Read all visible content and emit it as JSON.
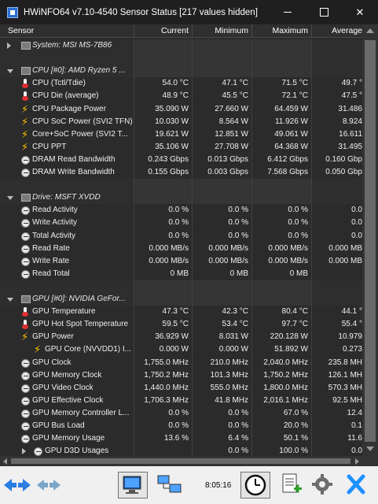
{
  "window": {
    "title": "HWiNFO64 v7.10-4540 Sensor Status [217 values hidden]",
    "minimize_glyph": "",
    "maximize_glyph": "",
    "close_glyph": "✕"
  },
  "columns": {
    "sensor": "Sensor",
    "current": "Current",
    "minimum": "Minimum",
    "maximum": "Maximum",
    "average": "Average"
  },
  "rows": [
    {
      "kind": "group",
      "icon": "chip",
      "expanded": false,
      "label": "System: MSI MS-7B86",
      "cur": "",
      "min": "",
      "max": "",
      "avg": ""
    },
    {
      "kind": "spacer",
      "label": "",
      "cur": "",
      "min": "",
      "max": "",
      "avg": ""
    },
    {
      "kind": "group",
      "icon": "chip",
      "expanded": true,
      "label": "CPU [#0]: AMD Ryzen 5 ...",
      "cur": "",
      "min": "",
      "max": "",
      "avg": ""
    },
    {
      "kind": "item",
      "icon": "thermometer",
      "label": "CPU (Tctl/Tdie)",
      "cur": "54.0 °C",
      "min": "47.1 °C",
      "max": "71.5 °C",
      "avg": "49.7 °"
    },
    {
      "kind": "item",
      "icon": "thermometer",
      "label": "CPU Die (average)",
      "cur": "48.9 °C",
      "min": "45.5 °C",
      "max": "72.1 °C",
      "avg": "47.5 °"
    },
    {
      "kind": "item",
      "icon": "bolt",
      "label": "CPU Package Power",
      "cur": "35.090 W",
      "min": "27.660 W",
      "max": "64.459 W",
      "avg": "31.486"
    },
    {
      "kind": "item",
      "icon": "bolt",
      "label": "CPU SoC Power (SVI2 TFN)",
      "cur": "10.030 W",
      "min": "8.564 W",
      "max": "11.926 W",
      "avg": "8.924"
    },
    {
      "kind": "item",
      "icon": "bolt",
      "label": "Core+SoC Power (SVI2 T...",
      "cur": "19.621 W",
      "min": "12.851 W",
      "max": "49.061 W",
      "avg": "16.611"
    },
    {
      "kind": "item",
      "icon": "bolt",
      "label": "CPU PPT",
      "cur": "35.106 W",
      "min": "27.708 W",
      "max": "64.368 W",
      "avg": "31.495"
    },
    {
      "kind": "item",
      "icon": "gauge",
      "label": "DRAM Read Bandwidth",
      "cur": "0.243 Gbps",
      "min": "0.013 Gbps",
      "max": "6.412 Gbps",
      "avg": "0.160 Gbp"
    },
    {
      "kind": "item",
      "icon": "gauge",
      "label": "DRAM Write Bandwidth",
      "cur": "0.155 Gbps",
      "min": "0.003 Gbps",
      "max": "7.568 Gbps",
      "avg": "0.050 Gbp"
    },
    {
      "kind": "spacer",
      "label": "",
      "cur": "",
      "min": "",
      "max": "",
      "avg": ""
    },
    {
      "kind": "group",
      "icon": "chip",
      "expanded": true,
      "label": "Drive: MSFT XVDD",
      "cur": "",
      "min": "",
      "max": "",
      "avg": ""
    },
    {
      "kind": "item",
      "icon": "gauge",
      "label": "Read Activity",
      "cur": "0.0 %",
      "min": "0.0 %",
      "max": "0.0 %",
      "avg": "0.0 "
    },
    {
      "kind": "item",
      "icon": "gauge",
      "label": "Write Activity",
      "cur": "0.0 %",
      "min": "0.0 %",
      "max": "0.0 %",
      "avg": "0.0 "
    },
    {
      "kind": "item",
      "icon": "gauge",
      "label": "Total Activity",
      "cur": "0.0 %",
      "min": "0.0 %",
      "max": "0.0 %",
      "avg": "0.0 "
    },
    {
      "kind": "item",
      "icon": "gauge",
      "label": "Read Rate",
      "cur": "0.000 MB/s",
      "min": "0.000 MB/s",
      "max": "0.000 MB/s",
      "avg": "0.000 MB"
    },
    {
      "kind": "item",
      "icon": "gauge",
      "label": "Write Rate",
      "cur": "0.000 MB/s",
      "min": "0.000 MB/s",
      "max": "0.000 MB/s",
      "avg": "0.000 MB"
    },
    {
      "kind": "item",
      "icon": "gauge",
      "label": "Read Total",
      "cur": "0 MB",
      "min": "0 MB",
      "max": "0 MB",
      "avg": ""
    },
    {
      "kind": "spacer",
      "label": "",
      "cur": "",
      "min": "",
      "max": "",
      "avg": ""
    },
    {
      "kind": "group",
      "icon": "chip",
      "expanded": true,
      "label": "GPU [#0]: NVIDIA GeFor...",
      "cur": "",
      "min": "",
      "max": "",
      "avg": ""
    },
    {
      "kind": "item",
      "icon": "thermometer",
      "label": "GPU Temperature",
      "cur": "47.3 °C",
      "min": "42.3 °C",
      "max": "80.4 °C",
      "avg": "44.1 °"
    },
    {
      "kind": "item",
      "icon": "thermometer",
      "label": "GPU Hot Spot Temperature",
      "cur": "59.5 °C",
      "min": "53.4 °C",
      "max": "97.7 °C",
      "avg": "55.4 °"
    },
    {
      "kind": "item",
      "icon": "bolt",
      "label": "GPU Power",
      "cur": "36.929 W",
      "min": "8.031 W",
      "max": "220.128 W",
      "avg": "10.979"
    },
    {
      "kind": "subitem",
      "icon": "bolt",
      "label": "GPU Core (NVVDD1) I...",
      "cur": "0.000 W",
      "min": "0.000 W",
      "max": "51.892 W",
      "avg": "0.273"
    },
    {
      "kind": "item",
      "icon": "gauge",
      "label": "GPU Clock",
      "cur": "1,755.0 MHz",
      "min": "210.0 MHz",
      "max": "2,040.0 MHz",
      "avg": "235.8 MH"
    },
    {
      "kind": "item",
      "icon": "gauge",
      "label": "GPU Memory Clock",
      "cur": "1,750.2 MHz",
      "min": "101.3 MHz",
      "max": "1,750.2 MHz",
      "avg": "126.1 MH"
    },
    {
      "kind": "item",
      "icon": "gauge",
      "label": "GPU Video Clock",
      "cur": "1,440.0 MHz",
      "min": "555.0 MHz",
      "max": "1,800.0 MHz",
      "avg": "570.3 MH"
    },
    {
      "kind": "item",
      "icon": "gauge",
      "label": "GPU Effective Clock",
      "cur": "1,706.3 MHz",
      "min": "41.8 MHz",
      "max": "2,016.1 MHz",
      "avg": "92.5 MH"
    },
    {
      "kind": "item",
      "icon": "gauge",
      "label": "GPU Memory Controller L...",
      "cur": "0.0 %",
      "min": "0.0 %",
      "max": "67.0 %",
      "avg": "12.4 "
    },
    {
      "kind": "item",
      "icon": "gauge",
      "label": "GPU Bus Load",
      "cur": "0.0 %",
      "min": "0.0 %",
      "max": "20.0 %",
      "avg": "0.1 "
    },
    {
      "kind": "item",
      "icon": "gauge",
      "label": "GPU Memory Usage",
      "cur": "13.6 %",
      "min": "6.4 %",
      "max": "50.1 %",
      "avg": "11.6 "
    },
    {
      "kind": "subgroup",
      "icon": "gauge",
      "expanded": false,
      "label": "GPU D3D Usages",
      "cur": "",
      "min": "0.0 %",
      "max": "100.0 %",
      "avg": "0.0 "
    }
  ],
  "toolbar": {
    "time": "8:05:16",
    "buttons": [
      "arrows-icon",
      "arrows-disabled-icon",
      "monitor-icon",
      "network-icon",
      "clock-icon",
      "report-icon",
      "gear-icon",
      "close-icon"
    ]
  },
  "colors": {
    "background": "#2b2b2b",
    "titlebar": "#1f1f1f",
    "toolbar": "#f0f0f0",
    "bolt": "#ffc400",
    "close_x": "#1e90ff"
  }
}
